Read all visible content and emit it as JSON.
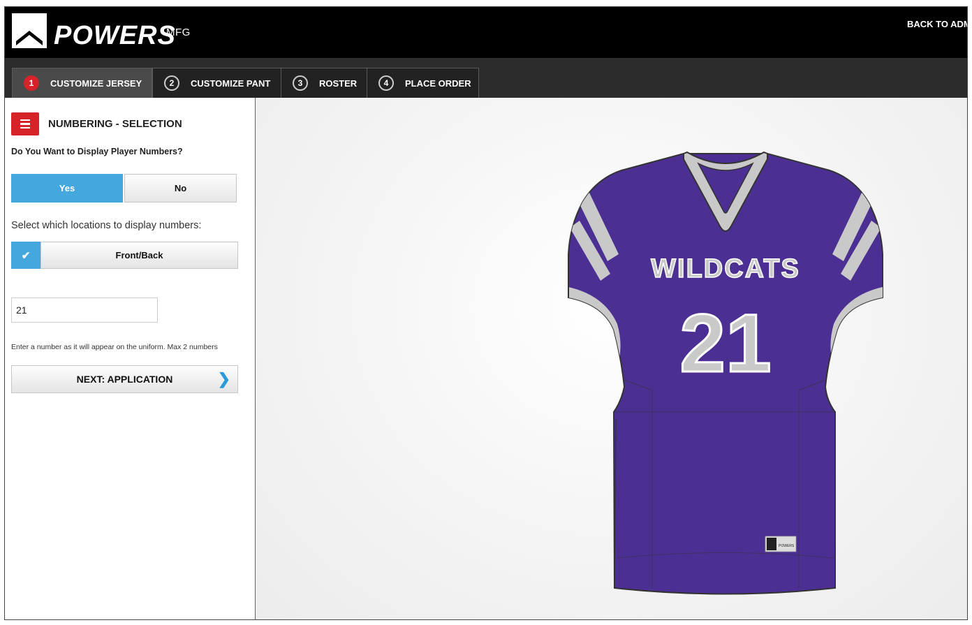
{
  "header": {
    "brand": "POWERS",
    "brand_suffix": "MFG",
    "back_link": "BACK TO ADM"
  },
  "steps": [
    {
      "number": "1",
      "label": "CUSTOMIZE JERSEY",
      "active": true
    },
    {
      "number": "2",
      "label": "CUSTOMIZE PANT",
      "active": false
    },
    {
      "number": "3",
      "label": "ROSTER",
      "active": false
    },
    {
      "number": "4",
      "label": "PLACE ORDER",
      "active": false
    }
  ],
  "panel": {
    "section_title": "NUMBERING - SELECTION",
    "question": "Do You Want to Display Player Numbers?",
    "yes_label": "Yes",
    "no_label": "No",
    "selected": "Yes",
    "locations_label": "Select which locations to display numbers:",
    "location_option": "Front/Back",
    "location_checked": true,
    "number_value": "21",
    "hint": "Enter a number as it will appear on the uniform. Max 2 numbers",
    "next_label": "NEXT: APPLICATION"
  },
  "jersey": {
    "team_name": "WILDCATS",
    "number": "21",
    "tag_text": "POWERS",
    "body_color": "#4b2f93",
    "trim_color": "#c9c9c9"
  },
  "colors": {
    "accent_blue": "#44a7dd",
    "accent_red": "#d6232a"
  }
}
